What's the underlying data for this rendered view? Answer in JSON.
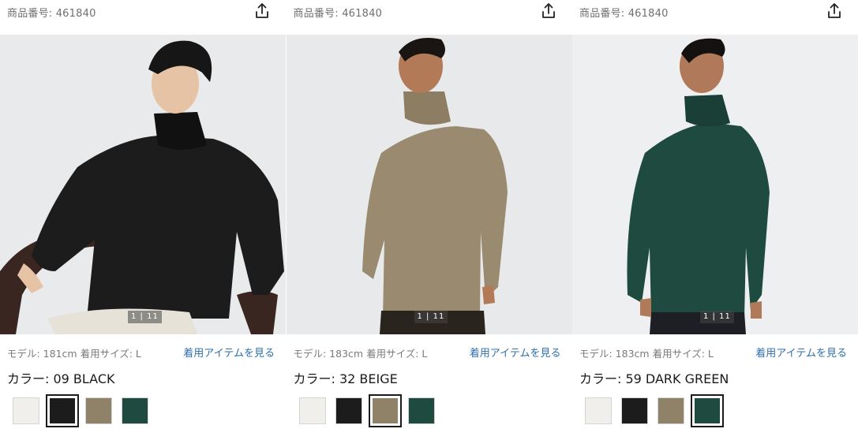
{
  "colors": {
    "off_white": "#f0efeb",
    "black": "#1c1c1c",
    "beige": "#8f8268",
    "dark_green": "#1f4a3f",
    "link": "#2f6fa8"
  },
  "panels": [
    {
      "product_number": "商品番号: 461840",
      "share_icon": "share-icon",
      "image_counter": "1 | 11",
      "model_info": "モデル: 181cm 着用サイズ: L",
      "worn_items_link": "着用アイテムを見る",
      "color_label": "カラー: 09 BLACK",
      "selected_swatch": 1
    },
    {
      "product_number": "商品番号: 461840",
      "share_icon": "share-icon",
      "image_counter": "1 | 11",
      "model_info": "モデル: 183cm 着用サイズ: L",
      "worn_items_link": "着用アイテムを見る",
      "color_label": "カラー: 32 BEIGE",
      "selected_swatch": 2
    },
    {
      "product_number": "商品番号: 461840",
      "share_icon": "share-icon",
      "image_counter": "1 | 11",
      "model_info": "モデル: 183cm 着用サイズ: L",
      "worn_items_link": "着用アイテムを見る",
      "color_label": "カラー: 59 DARK GREEN",
      "selected_swatch": 3
    }
  ]
}
